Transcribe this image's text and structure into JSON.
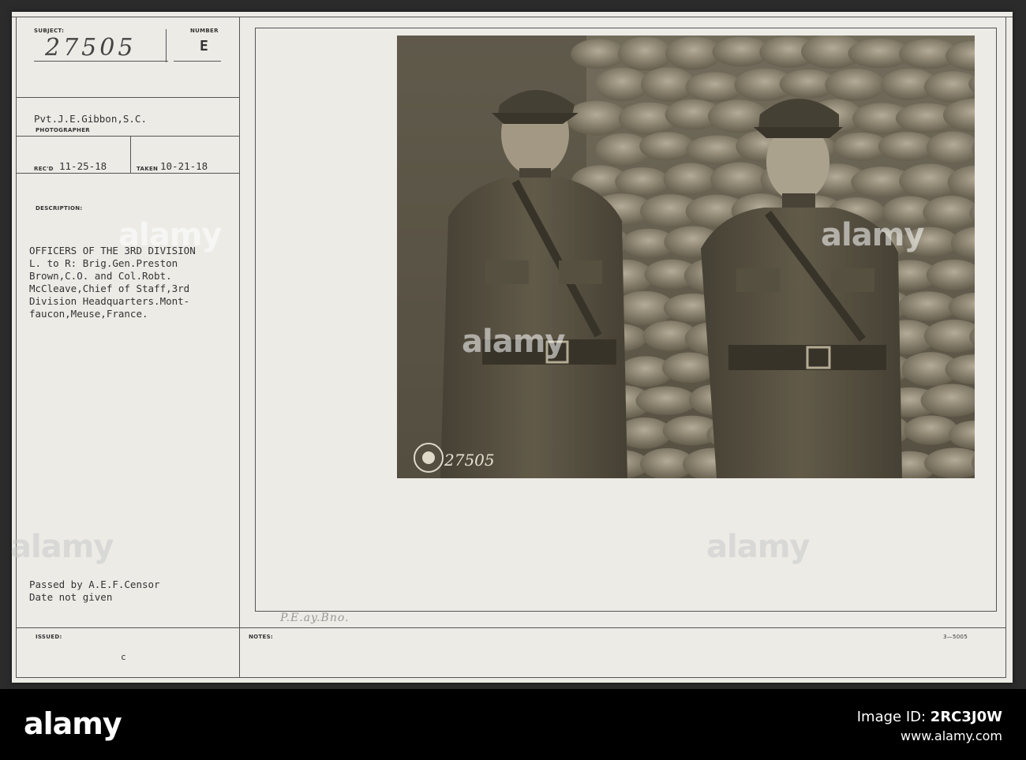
{
  "card": {
    "subject_label": "SUBJECT:",
    "subject_value": "27505",
    "number_label": "NUMBER",
    "number_value": "E",
    "photographer_name": "Pvt.J.E.Gibbon,S.C.",
    "photographer_label": "PHOTOGRAPHER",
    "recd_label": "REC'D",
    "recd_date": "11-25-18",
    "taken_label": "TAKEN",
    "taken_date": "10-21-18",
    "description_label": "DESCRIPTION:",
    "description_lines": [
      "OFFICERS OF THE 3RD DIVISION",
      "L. to R: Brig.Gen.Preston",
      "Brown,C.O. and Col.Robt.",
      "McCleave,Chief of Staff,3rd",
      "Division Headquarters.Mont-",
      "faucon,Meuse,France."
    ],
    "censor_lines": [
      "Passed by A.E.F.Censor",
      "Date not given"
    ],
    "issued_label": "ISSUED:",
    "issued_value": "c",
    "notes_label": "NOTES:",
    "notes_handwriting": "P.E.ay.Bno.",
    "form_code": "3—5005",
    "photo_stamp_number": "27505",
    "seal_text": "SIGNAL CORPS U.S.A."
  },
  "watermark": "alamy",
  "footer": {
    "logo": "alamy",
    "image_id_label": "Image ID:",
    "image_id": "2RC3J0W",
    "url": "www.alamy.com"
  },
  "colors": {
    "card": "#ecebe6",
    "footer": "#000000",
    "ink": "#333333",
    "photo_sepia": "#8c8676"
  }
}
